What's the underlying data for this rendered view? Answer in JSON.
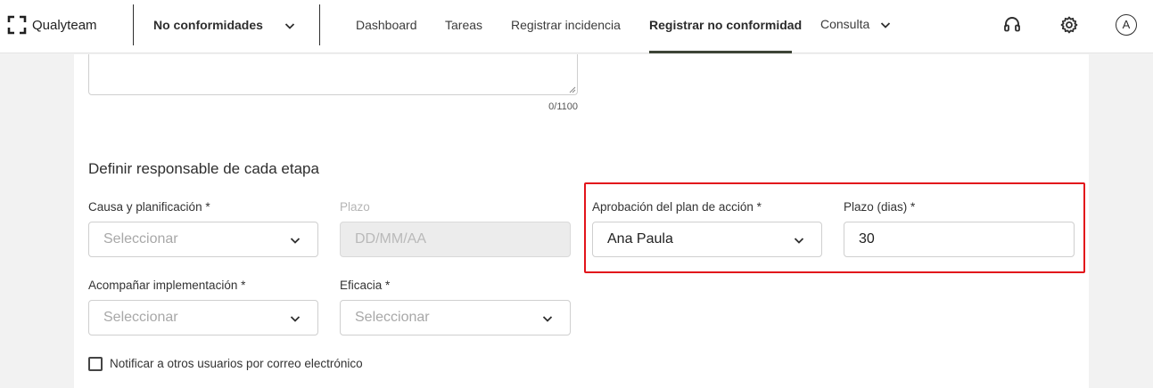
{
  "header": {
    "logo_text": "Qualyteam",
    "module_selector": "No conformidades",
    "nav": [
      {
        "label": "Dashboard"
      },
      {
        "label": "Tareas"
      },
      {
        "label": "Registrar incidencia"
      },
      {
        "label": "Registrar no conformidad"
      },
      {
        "label": "Consulta"
      }
    ],
    "active_nav": "Registrar no conformidad",
    "icons": [
      "headset-icon",
      "gear-icon"
    ],
    "avatar_initial": "A"
  },
  "form": {
    "description_counter": "0/1100",
    "section_title": "Definir responsable de cada etapa",
    "causa": {
      "label": "Causa y planificación *",
      "placeholder": "Seleccionar"
    },
    "plazo": {
      "label": "Plazo",
      "placeholder": "DD/MM/AA"
    },
    "aprobacion": {
      "label": "Aprobación del plan de acción *",
      "value": "Ana Paula"
    },
    "plazo_dias": {
      "label": "Plazo (dias) *",
      "value": "30"
    },
    "acompanar": {
      "label": "Acompañar implementación *",
      "placeholder": "Seleccionar"
    },
    "eficacia": {
      "label": "Eficacia *",
      "placeholder": "Seleccionar"
    },
    "notify_label": "Notificar a otros usuarios por correo electrónico",
    "notify_checked": false
  },
  "colors": {
    "highlight": "#e2141b",
    "nav_underline": "#3d4436",
    "page_background": "#f2f2f2"
  }
}
